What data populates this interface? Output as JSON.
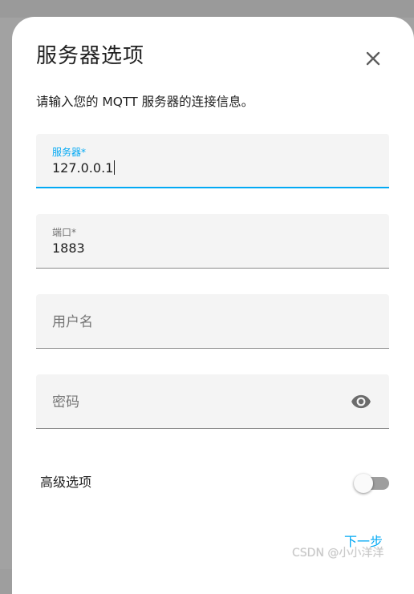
{
  "dialog": {
    "title": "服务器选项",
    "description": "请输入您的 MQTT 服务器的连接信息。",
    "close_icon": "close-icon"
  },
  "fields": {
    "broker": {
      "label": "服务器*",
      "value": "127.0.0.1"
    },
    "port": {
      "label": "端口*",
      "value": "1883"
    },
    "username": {
      "placeholder": "用户名"
    },
    "password": {
      "placeholder": "密码",
      "icon": "eye-icon"
    }
  },
  "advanced": {
    "label": "高级选项",
    "enabled": false
  },
  "footer": {
    "next_label": "下一步"
  },
  "watermark": "CSDN @小小洋洋",
  "colors": {
    "accent": "#03a9f4",
    "field_bg": "#f4f4f4",
    "text": "#212121"
  }
}
